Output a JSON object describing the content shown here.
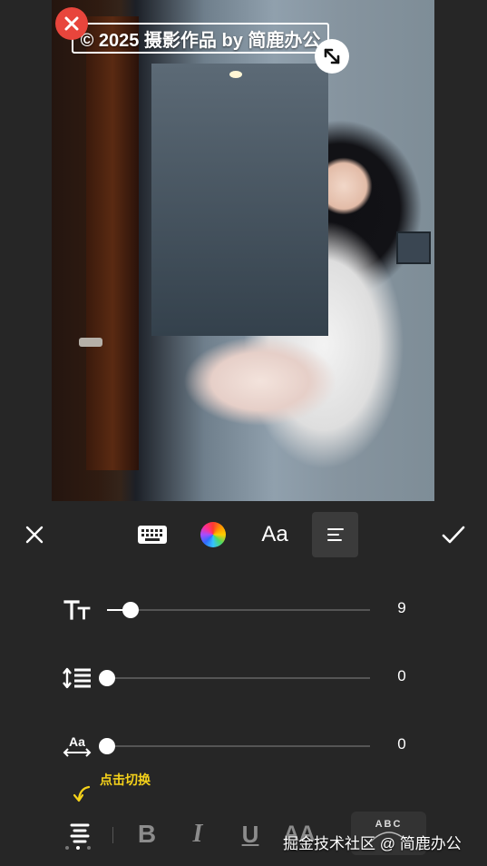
{
  "canvas": {
    "watermark_text": "© 2025 摄影作品 by 简鹿办公",
    "delete_icon": "close-x-icon",
    "resize_icon": "diagonal-resize-icon"
  },
  "toolbar": {
    "close_icon": "close-icon",
    "keyboard_icon": "keyboard-icon",
    "color_icon": "color-wheel-icon",
    "font_label": "Aa",
    "align_icon": "align-left-icon",
    "confirm_icon": "checkmark-icon"
  },
  "sliders": [
    {
      "icon": "font-size-icon",
      "value": "9",
      "level": 0.09
    },
    {
      "icon": "line-spacing-icon",
      "value": "0",
      "level": 0
    },
    {
      "icon": "letter-spacing-icon",
      "icon_text": "Aa",
      "value": "0",
      "level": 0
    }
  ],
  "hint": {
    "text": "点击切换",
    "color": "#f5d21a"
  },
  "format_bar": {
    "bold_label": "B",
    "italic_label": "I",
    "underline_label": "U",
    "case_label": "AA",
    "arc_label": "ABC"
  },
  "credit": "掘金技术社区 @ 简鹿办公",
  "colors": {
    "background": "#262626",
    "accent_delete": "#e8453c",
    "hint": "#f5d21a"
  }
}
